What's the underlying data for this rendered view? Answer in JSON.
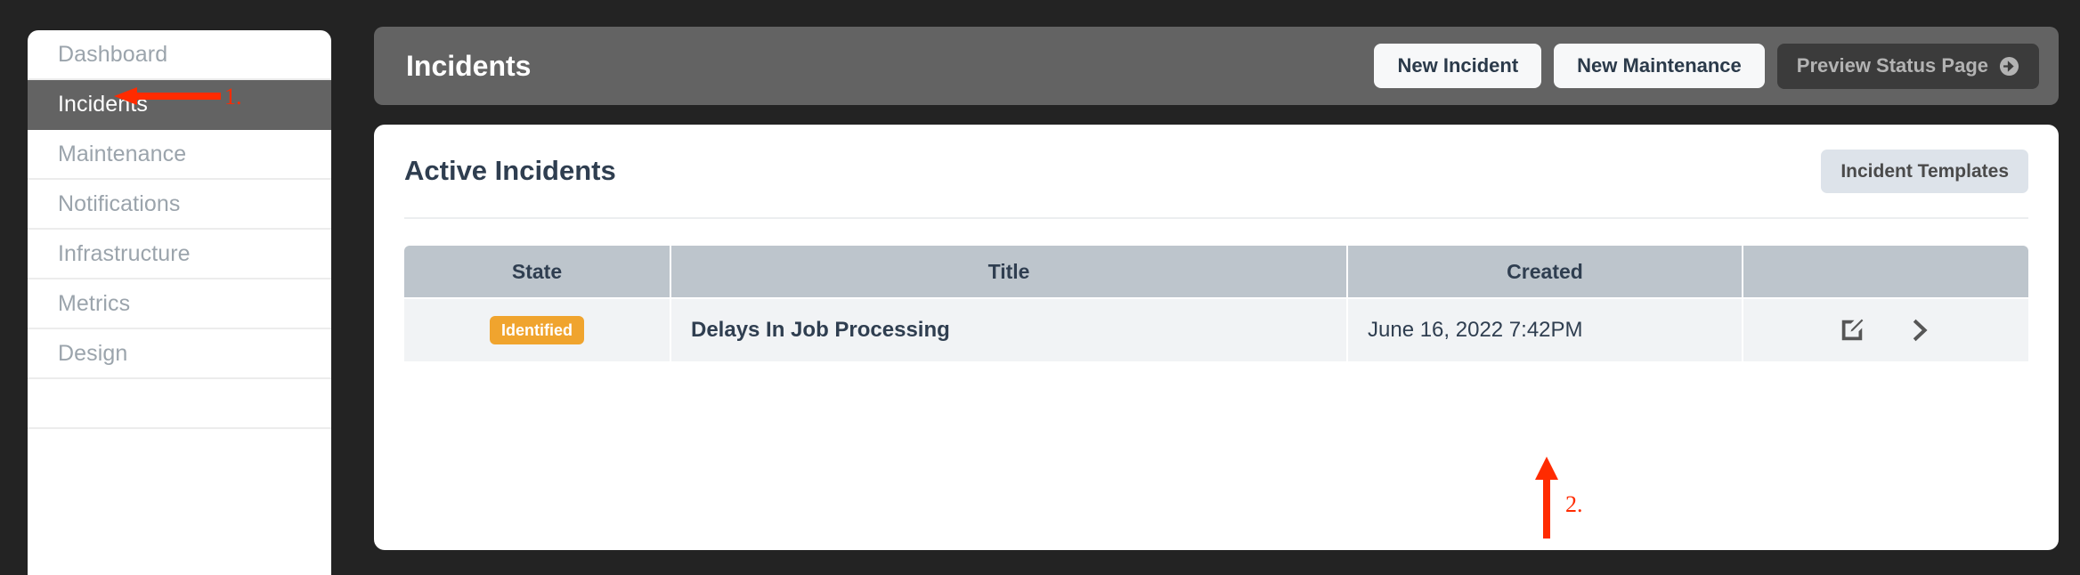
{
  "theme": {
    "page_background": "#232323",
    "sidebar_background": "#ffffff",
    "sidebar_active_background": "#636363",
    "sidebar_text": "#9ba4ac",
    "header_background": "#636363",
    "accent_navy": "#2f3e50",
    "badge_orange": "#f0a42e",
    "table_header_background": "#bdc5cc",
    "table_row_background": "#f1f3f5",
    "template_button_background": "#dde3ea",
    "annotation_red": "#ff2b00"
  },
  "sidebar": {
    "items": [
      {
        "label": "Dashboard",
        "active": false
      },
      {
        "label": "Incidents",
        "active": true
      },
      {
        "label": "Maintenance",
        "active": false
      },
      {
        "label": "Notifications",
        "active": false
      },
      {
        "label": "Infrastructure",
        "active": false
      },
      {
        "label": "Metrics",
        "active": false
      },
      {
        "label": "Design",
        "active": false
      },
      {
        "label": "",
        "active": false
      }
    ]
  },
  "header": {
    "title": "Incidents",
    "new_incident_label": "New Incident",
    "new_maintenance_label": "New Maintenance",
    "preview_status_page_label": "Preview Status Page",
    "preview_icon": "arrow-right-circle-icon"
  },
  "card": {
    "title": "Active Incidents",
    "templates_button_label": "Incident Templates"
  },
  "table": {
    "columns": [
      "State",
      "Title",
      "Created",
      ""
    ],
    "rows": [
      {
        "state": "Identified",
        "title": "Delays In Job Processing",
        "created": "June 16, 2022 7:42PM",
        "edit_icon": "edit-square-icon",
        "view_icon": "chevron-right-icon"
      }
    ]
  },
  "annotations": [
    {
      "number": "1.",
      "target": "sidebar-item-incidents",
      "direction": "left"
    },
    {
      "number": "2.",
      "target": "incident-view-chevron",
      "direction": "up"
    }
  ]
}
